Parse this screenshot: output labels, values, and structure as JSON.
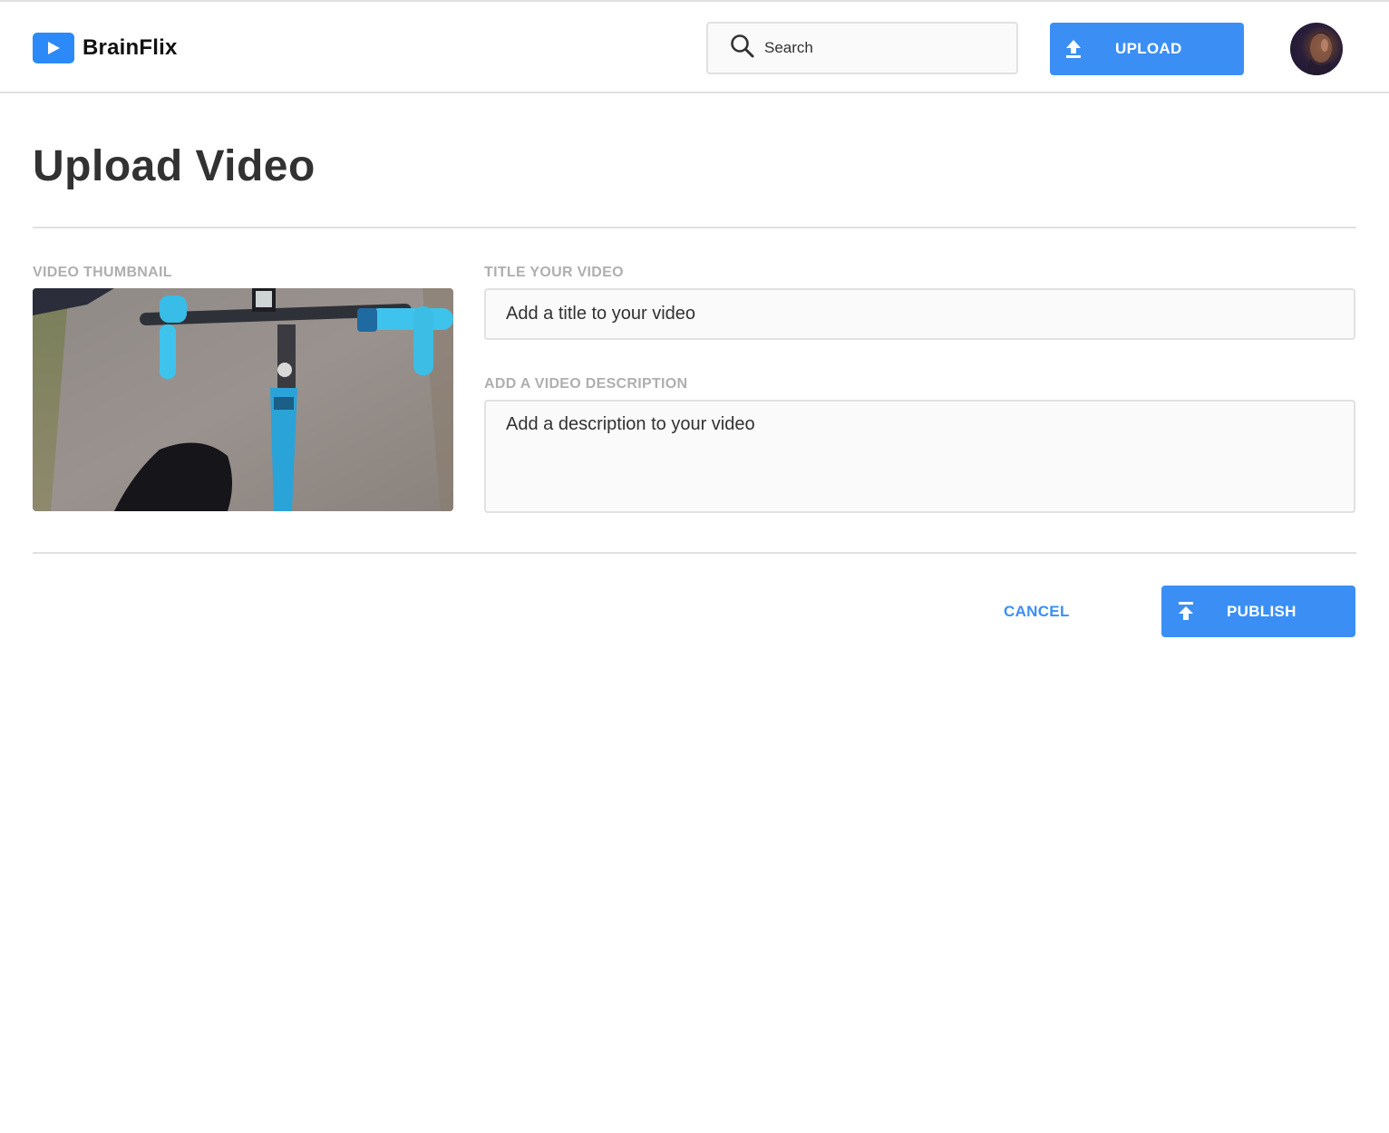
{
  "header": {
    "brand": "BrainFlix",
    "search_placeholder": "Search",
    "upload_label": "UPLOAD"
  },
  "page": {
    "title": "Upload Video"
  },
  "form": {
    "thumbnail_label": "VIDEO THUMBNAIL",
    "title_label": "TITLE YOUR VIDEO",
    "title_placeholder": "Add a title to your video",
    "description_label": "ADD A VIDEO DESCRIPTION",
    "description_placeholder": "Add a description to your video"
  },
  "actions": {
    "cancel_label": "CANCEL",
    "publish_label": "PUBLISH"
  },
  "colors": {
    "accent": "#3b8ff4",
    "border": "#e1e1e1",
    "label": "#afafaf",
    "text": "#323232"
  },
  "icons": {
    "logo": "play-icon",
    "search": "search-icon",
    "upload": "upload-icon",
    "publish": "publish-icon"
  }
}
